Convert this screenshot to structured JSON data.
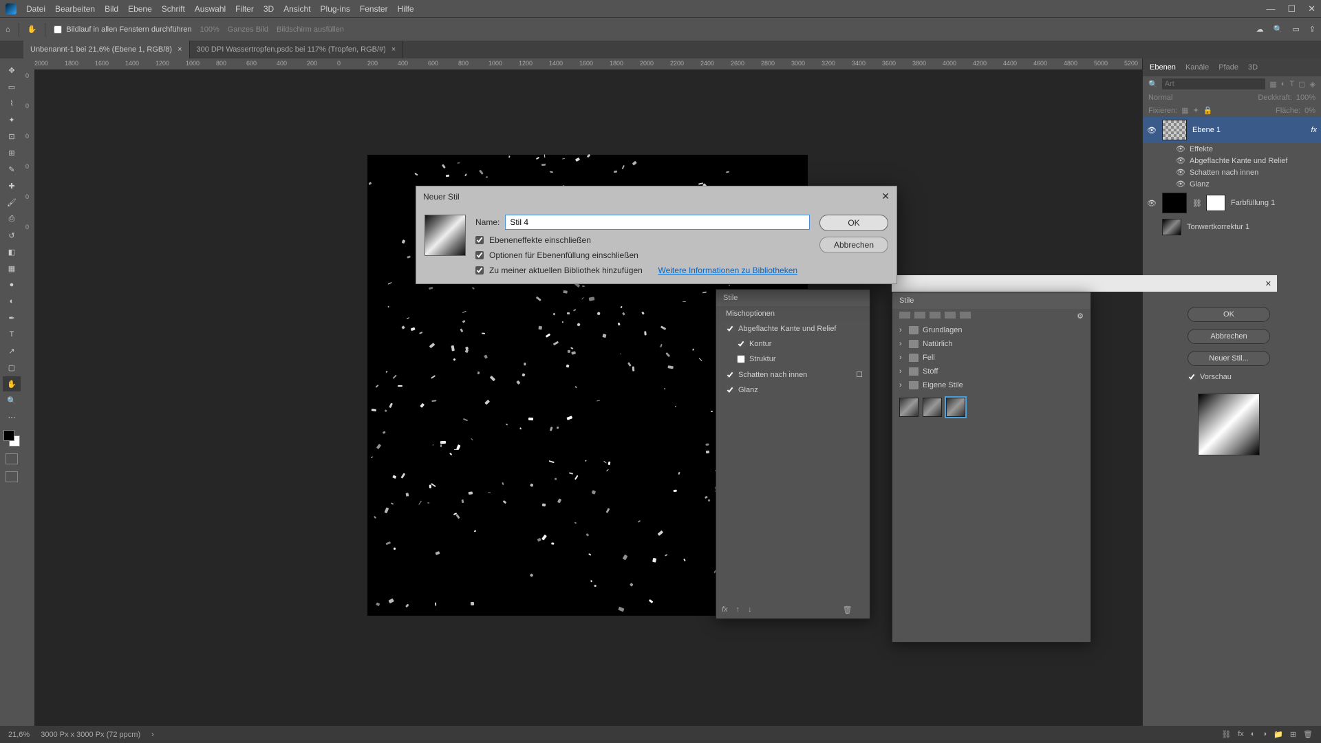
{
  "menubar": {
    "items": [
      "Datei",
      "Bearbeiten",
      "Bild",
      "Ebene",
      "Schrift",
      "Auswahl",
      "Filter",
      "3D",
      "Ansicht",
      "Plug-ins",
      "Fenster",
      "Hilfe"
    ]
  },
  "optbar": {
    "checkbox_label": "Bildlauf in allen Fenstern durchführen",
    "zoom": "100%",
    "btn1": "Ganzes Bild",
    "btn2": "Bildschirm ausfüllen"
  },
  "tabs": [
    {
      "label": "Unbenannt-1 bei 21,6% (Ebene 1, RGB/8)",
      "active": true
    },
    {
      "label": "300 DPI Wassertropfen.psdc bei 117% (Tropfen, RGB/#)",
      "active": false
    }
  ],
  "ruler_h": [
    "2000",
    "1800",
    "1600",
    "1400",
    "1200",
    "1000",
    "800",
    "600",
    "400",
    "200",
    "0",
    "200",
    "400",
    "600",
    "800",
    "1000",
    "1200",
    "1400",
    "1600",
    "1800",
    "2000",
    "2200",
    "2400",
    "2600",
    "2800",
    "3000",
    "3200",
    "3400",
    "3600",
    "3800",
    "4000",
    "4200",
    "4400",
    "4600",
    "4800",
    "5000",
    "5200"
  ],
  "ruler_v": [
    "0",
    "0",
    "0",
    "0",
    "0",
    "0"
  ],
  "panels": {
    "tabs": [
      "Ebenen",
      "Kanäle",
      "Pfade",
      "3D"
    ],
    "search_ph": "Art",
    "blend": "Normal",
    "opacity_label": "Deckkraft:",
    "lock_label": "Fixieren:",
    "fill_label": "Fläche:",
    "fill_val": "0%",
    "layers": [
      {
        "name": "Ebene 1",
        "effects_label": "Effekte",
        "fx": [
          "Abgeflachte Kante und Relief",
          "Schatten nach innen",
          "Glanz"
        ]
      },
      {
        "name": "Farbfüllung 1"
      },
      {
        "name": "Tonwertkorrektur 1"
      }
    ]
  },
  "ls_dialog": {
    "stile": "Stile",
    "mix": "Mischoptionen",
    "items": [
      {
        "label": "Abgeflachte Kante und Relief",
        "checked": true
      },
      {
        "label": "Kontur",
        "checked": true,
        "indent": true
      },
      {
        "label": "Struktur",
        "checked": false,
        "indent": true
      },
      {
        "label": "Schatten nach innen",
        "checked": true,
        "plus": true
      },
      {
        "label": "Glanz",
        "checked": true
      }
    ]
  },
  "styles_panel": {
    "title": "Stile",
    "folders": [
      "Grundlagen",
      "Natürlich",
      "Fell",
      "Stoff",
      "Eigene Stile"
    ],
    "gear": "⚙"
  },
  "ls_right": {
    "ok": "OK",
    "cancel": "Abbrechen",
    "new": "Neuer Stil...",
    "preview": "Vorschau"
  },
  "ns_dialog": {
    "title": "Neuer Stil",
    "name_label": "Name:",
    "name_value": "Stil 4",
    "chk1": "Ebeneneffekte einschließen",
    "chk2": "Optionen für Ebenenfüllung einschließen",
    "chk3": "Zu meiner aktuellen Bibliothek hinzufügen",
    "link": "Weitere Informationen zu Bibliotheken",
    "ok": "OK",
    "cancel": "Abbrechen"
  },
  "status": {
    "zoom": "21,6%",
    "dims": "3000 Px x 3000 Px (72 ppcm)",
    "arrow": "›"
  }
}
